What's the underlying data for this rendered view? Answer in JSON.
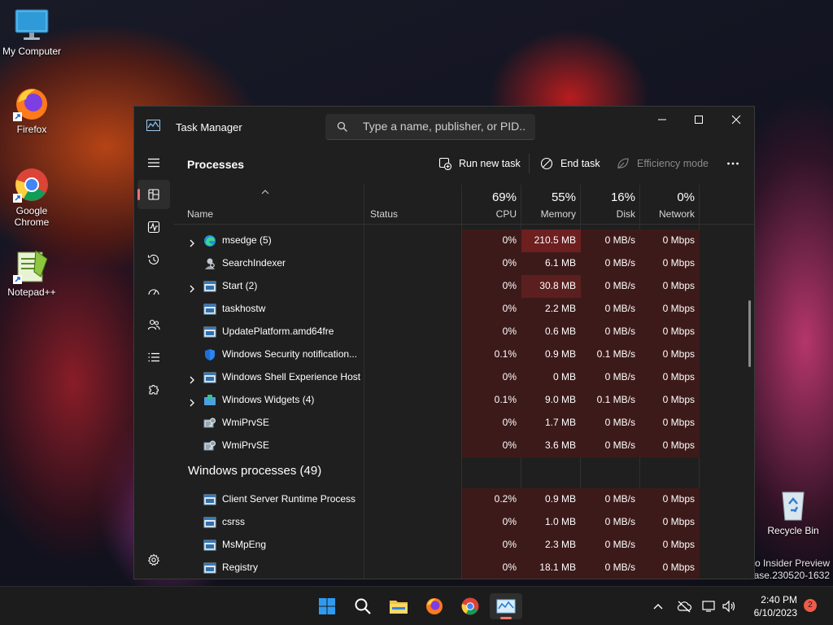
{
  "desktop": {
    "icons": [
      {
        "label": "My Computer"
      },
      {
        "label": "Firefox"
      },
      {
        "label": "Google Chrome"
      },
      {
        "label": "Notepad++"
      },
      {
        "label": "Recycle Bin"
      }
    ],
    "watermark_line1": "ro Insider Preview",
    "watermark_line2": "ease.230520-1632"
  },
  "task_manager": {
    "title": "Task Manager",
    "search_placeholder": "Type a name, publisher, or PID...",
    "page_title": "Processes",
    "toolbar": {
      "run_new_task": "Run new task",
      "end_task": "End task",
      "efficiency_mode": "Efficiency mode"
    },
    "columns": {
      "name": "Name",
      "status": "Status",
      "cpu_pct": "69%",
      "cpu": "CPU",
      "memory_pct": "55%",
      "memory": "Memory",
      "disk_pct": "16%",
      "disk": "Disk",
      "network_pct": "0%",
      "network": "Network"
    },
    "apps": [
      {
        "name": "msedge (5)",
        "expandable": true,
        "icon": "edge-icon",
        "cpu": "0%",
        "memory": "210.5 MB",
        "disk": "0 MB/s",
        "network": "0 Mbps",
        "mem_heat": "high"
      },
      {
        "name": "SearchIndexer",
        "expandable": false,
        "icon": "search-indexer-icon",
        "cpu": "0%",
        "memory": "6.1 MB",
        "disk": "0 MB/s",
        "network": "0 Mbps",
        "mem_heat": "low"
      },
      {
        "name": "Start (2)",
        "expandable": true,
        "icon": "window-app-icon",
        "cpu": "0%",
        "memory": "30.8 MB",
        "disk": "0 MB/s",
        "network": "0 Mbps",
        "mem_heat": "mid"
      },
      {
        "name": "taskhostw",
        "expandable": false,
        "icon": "window-app-icon",
        "cpu": "0%",
        "memory": "2.2 MB",
        "disk": "0 MB/s",
        "network": "0 Mbps",
        "mem_heat": "low"
      },
      {
        "name": "UpdatePlatform.amd64fre",
        "expandable": false,
        "icon": "window-app-icon",
        "cpu": "0%",
        "memory": "0.6 MB",
        "disk": "0 MB/s",
        "network": "0 Mbps",
        "mem_heat": "low"
      },
      {
        "name": "Windows Security notification...",
        "expandable": false,
        "icon": "shield-icon",
        "cpu": "0.1%",
        "memory": "0.9 MB",
        "disk": "0.1 MB/s",
        "network": "0 Mbps",
        "mem_heat": "low"
      },
      {
        "name": "Windows Shell Experience Host",
        "expandable": true,
        "icon": "window-app-icon",
        "cpu": "0%",
        "memory": "0 MB",
        "disk": "0 MB/s",
        "network": "0 Mbps",
        "mem_heat": "low"
      },
      {
        "name": "Windows Widgets (4)",
        "expandable": true,
        "icon": "widgets-icon",
        "cpu": "0.1%",
        "memory": "9.0 MB",
        "disk": "0.1 MB/s",
        "network": "0 Mbps",
        "mem_heat": "low"
      },
      {
        "name": "WmiPrvSE",
        "expandable": false,
        "icon": "wmi-icon",
        "cpu": "0%",
        "memory": "1.7 MB",
        "disk": "0 MB/s",
        "network": "0 Mbps",
        "mem_heat": "low"
      },
      {
        "name": "WmiPrvSE",
        "expandable": false,
        "icon": "wmi-icon",
        "cpu": "0%",
        "memory": "3.6 MB",
        "disk": "0 MB/s",
        "network": "0 Mbps",
        "mem_heat": "low"
      }
    ],
    "windows_group_title": "Windows processes (49)",
    "windows_processes": [
      {
        "name": "Client Server Runtime Process",
        "expandable": false,
        "icon": "window-app-icon",
        "cpu": "0.2%",
        "memory": "0.9 MB",
        "disk": "0 MB/s",
        "network": "0 Mbps",
        "mem_heat": "low"
      },
      {
        "name": "csrss",
        "expandable": false,
        "icon": "window-app-icon",
        "cpu": "0%",
        "memory": "1.0 MB",
        "disk": "0 MB/s",
        "network": "0 Mbps",
        "mem_heat": "low"
      },
      {
        "name": "MsMpEng",
        "expandable": false,
        "icon": "window-app-icon",
        "cpu": "0%",
        "memory": "2.3 MB",
        "disk": "0 MB/s",
        "network": "0 Mbps",
        "mem_heat": "low"
      },
      {
        "name": "Registry",
        "expandable": false,
        "icon": "window-app-icon",
        "cpu": "0%",
        "memory": "18.1 MB",
        "disk": "0 MB/s",
        "network": "0 Mbps",
        "mem_heat": "low"
      }
    ]
  },
  "taskbar": {
    "time": "2:40 PM",
    "date": "6/10/2023",
    "notification_count": "2"
  },
  "colors": {
    "heat_low": "#3d1a1a",
    "heat_mid": "#5c1f1f",
    "heat_high": "#6e1f1f",
    "accent": "#f07070"
  }
}
